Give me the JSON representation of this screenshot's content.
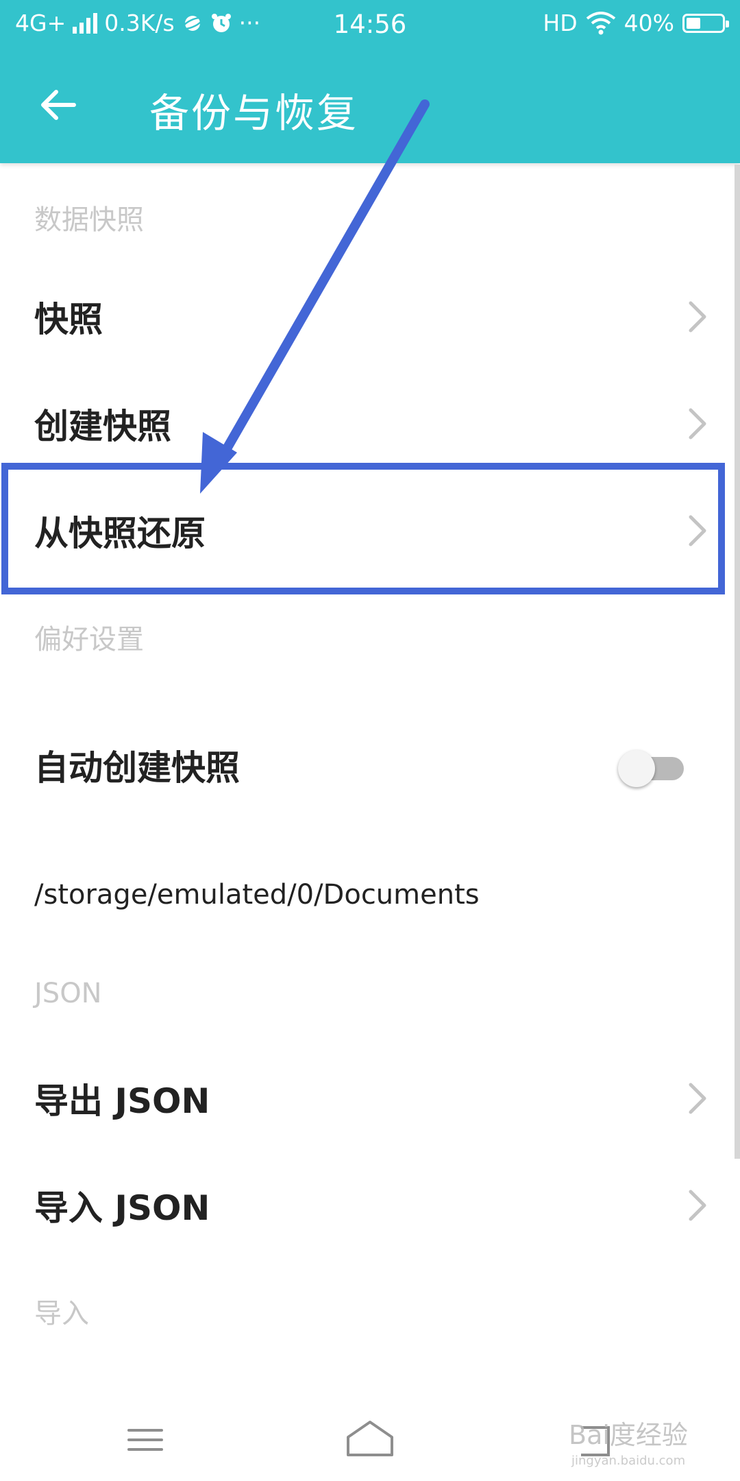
{
  "status_bar": {
    "network": "4G+",
    "speed": "0.3K/s",
    "more": "···",
    "time": "14:56",
    "hd": "HD",
    "battery": "40%",
    "battery_level": 0.4
  },
  "app_bar": {
    "title": "备份与恢复"
  },
  "sections": {
    "snapshot": "数据快照",
    "prefs": "偏好设置",
    "json": "JSON",
    "import": "导入"
  },
  "items": {
    "snapshot": "快照",
    "create_snapshot": "创建快照",
    "restore_snapshot": "从快照还原",
    "auto_snapshot": "自动创建快照",
    "storage_path": "/storage/emulated/0/Documents",
    "export_json": "导出 JSON",
    "import_json": "导入 JSON"
  },
  "toggle_auto_snapshot": {
    "on": false
  },
  "watermark": {
    "text": "Bai度经验",
    "sub": "jingyan.baidu.com"
  },
  "colors": {
    "accent": "#33c3cc",
    "annotation": "#4366d6"
  }
}
